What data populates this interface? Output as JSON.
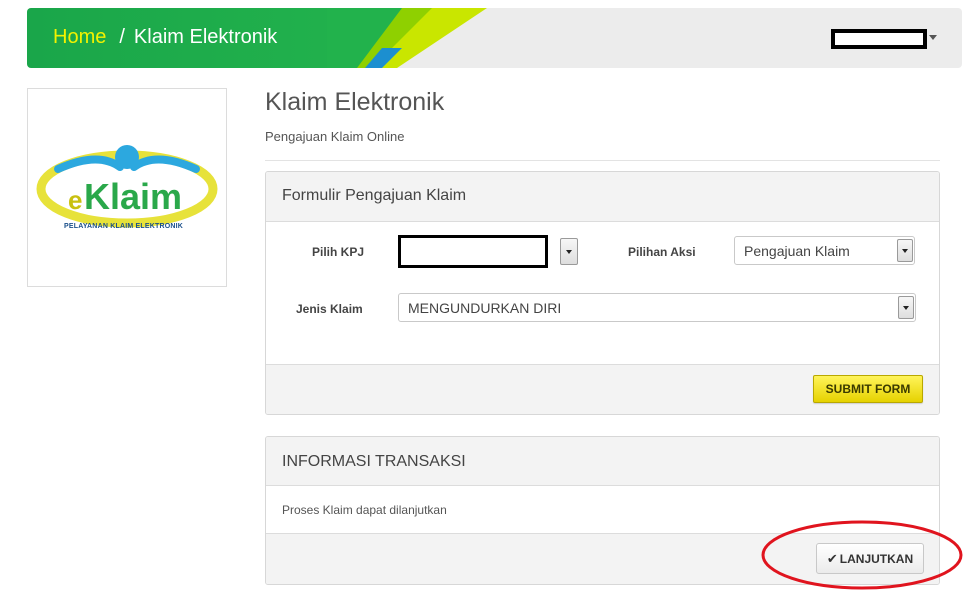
{
  "header": {
    "home_label": "Home",
    "separator": "/",
    "current_label": "Klaim Elektronik",
    "colors": {
      "green": "#1fae4b",
      "home_yellow": "#f2f200",
      "bar_bg": "#ececec"
    }
  },
  "logo": {
    "wordmark_e": "e",
    "wordmark_klaim": "Klaim",
    "caption": "PELAYANAN KLAIM ELEKTRONIK"
  },
  "page": {
    "title": "Klaim Elektronik",
    "subtitle": "Pengajuan Klaim Online"
  },
  "form_panel": {
    "heading": "Formulir Pengajuan Klaim",
    "kpj_label": "Pilih KPJ",
    "aksi_label": "Pilihan Aksi",
    "aksi_value": "Pengajuan Klaim",
    "jenis_label": "Jenis Klaim",
    "jenis_value": "MENGUNDURKAN DIRI",
    "submit_label": "SUBMIT FORM"
  },
  "info_panel": {
    "heading": "INFORMASI TRANSAKSI",
    "message": "Proses Klaim dapat dilanjutkan",
    "next_icon": "✔",
    "next_label": "LANJUTKAN"
  },
  "icons": {
    "dropdown": "chevron-down-icon",
    "check": "check-icon"
  }
}
